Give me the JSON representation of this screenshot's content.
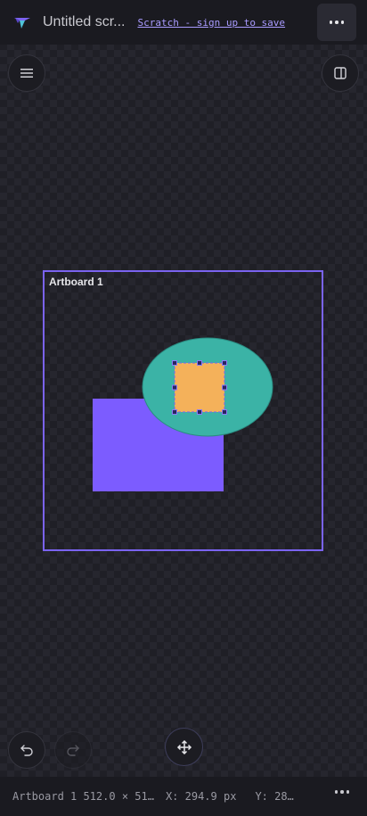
{
  "header": {
    "doc_title": "Untitled scr...",
    "signup_link": "Scratch - sign up to save"
  },
  "artboard": {
    "name": "Artboard 1"
  },
  "canvas": {
    "colors": {
      "accent": "#7a63f0",
      "rectangle": "#7c5cff",
      "ellipse": "#3bb3a6",
      "square": "#f4b15a",
      "handle": "#2b2560"
    }
  },
  "status": {
    "artboard_info": "Artboard 1 512.0 × 51…",
    "x_readout": "X: 294.9 px",
    "y_readout": "Y: 28…"
  },
  "icons": {
    "logo": "logo-icon",
    "menu": "hamburger-menu-icon",
    "panel": "panel-toggle-icon",
    "undo": "undo-icon",
    "redo": "redo-icon",
    "move": "move-arrows-icon",
    "more": "more-dots-icon"
  }
}
